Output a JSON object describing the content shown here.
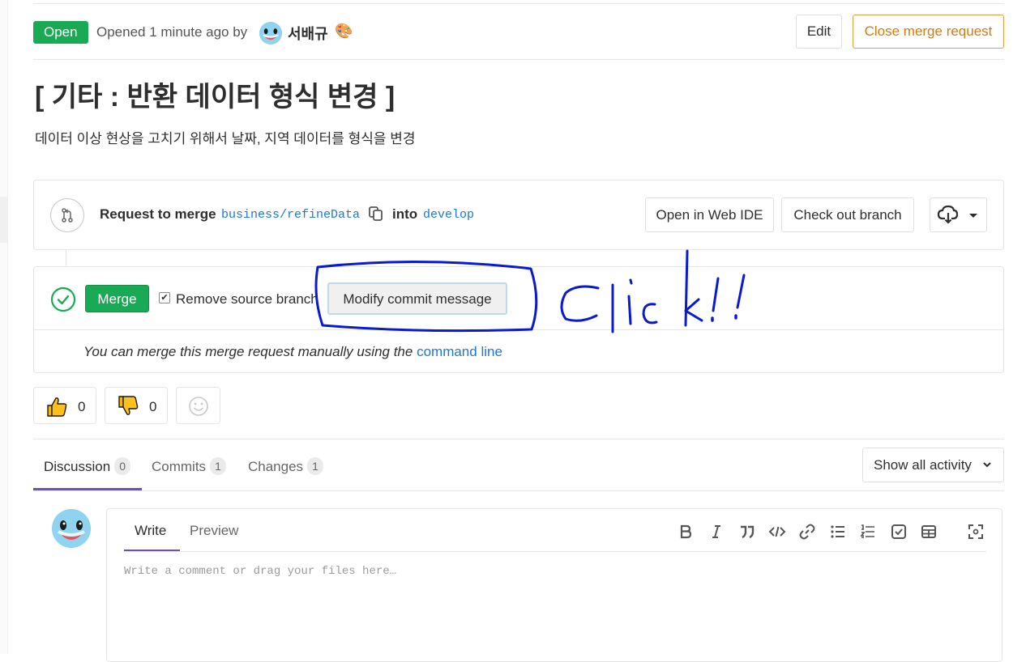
{
  "header": {
    "status": "Open",
    "opened_text": "Opened 1 minute ago by",
    "author": "서배규",
    "author_emoji": "🎨",
    "edit_label": "Edit",
    "close_label": "Close merge request"
  },
  "mr": {
    "title": "[ 기타 : 반환 데이터 형식 변경 ]",
    "description": "데이터 이상 현상을 고치기 위해서 날짜, 지역 데이터를 형식을 변경"
  },
  "branch": {
    "request_label": "Request to merge",
    "source": "business/refineData",
    "into_label": "into",
    "target": "develop",
    "open_ide_label": "Open in Web IDE",
    "checkout_label": "Check out branch"
  },
  "merge": {
    "merge_label": "Merge",
    "remove_source_label": "Remove source branch",
    "remove_source_checked": true,
    "modify_commit_label": "Modify commit message",
    "manual_text": "You can merge this merge request manually using the",
    "command_line_link": "command line"
  },
  "annotation": {
    "text": "Click!!",
    "color": "#0a1ad0"
  },
  "awards": {
    "thumbsup_count": "0",
    "thumbsdown_count": "0"
  },
  "tabs": [
    {
      "label": "Discussion",
      "count": "0"
    },
    {
      "label": "Commits",
      "count": "1"
    },
    {
      "label": "Changes",
      "count": "1"
    }
  ],
  "activity_filter": "Show all activity",
  "comment": {
    "write_label": "Write",
    "preview_label": "Preview",
    "placeholder": "Write a comment or drag your files here…",
    "toolbar": [
      "bold-icon",
      "italic-icon",
      "quote-icon",
      "code-icon",
      "link-icon",
      "bullet-list-icon",
      "numbered-list-icon",
      "task-list-icon",
      "table-icon",
      "fullscreen-icon"
    ]
  },
  "colors": {
    "success": "#1aaa55",
    "link": "#1f78d1",
    "warning": "#d47b0b",
    "tab_accent": "#6b4fbb"
  }
}
